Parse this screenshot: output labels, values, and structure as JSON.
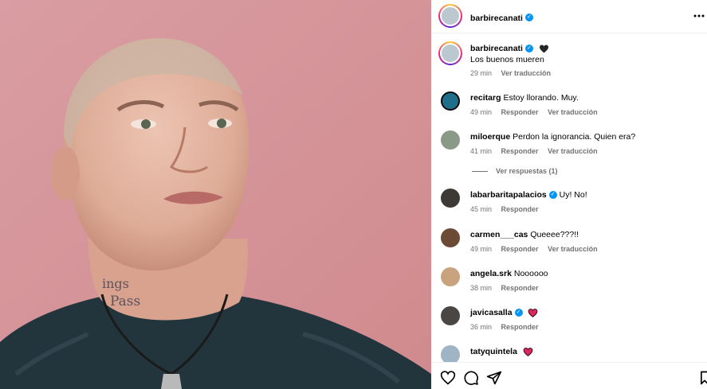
{
  "header": {
    "username": "barbirecanati",
    "verified": true
  },
  "caption": {
    "username": "barbirecanati",
    "text": "Los buenos mueren",
    "time": "29 min",
    "translate": "Ver traducción"
  },
  "comments": [
    {
      "username": "recitarg",
      "text": "Estoy llorando. Muy.",
      "time": "49 min",
      "reply": "Responder",
      "translate": "Ver traducción"
    },
    {
      "username": "miloerque",
      "text": "Perdon la ignorancia. Quien era?",
      "time": "41 min",
      "reply": "Responder",
      "translate": "Ver traducción"
    },
    {
      "username": "labarbaritapalacios",
      "text": "Uy! No!",
      "time": "45 min",
      "reply": "Responder"
    },
    {
      "username": "carmen___cas",
      "text": "Queeee???!!",
      "time": "49 min",
      "reply": "Responder",
      "translate": "Ver traducción"
    },
    {
      "username": "angela.srk",
      "text": "Noooooo",
      "time": "38 min",
      "reply": "Responder"
    },
    {
      "username": "javicasalla",
      "text": "",
      "time": "36 min",
      "reply": "Responder"
    },
    {
      "username": "tatyquintela",
      "text": ""
    }
  ],
  "view_replies": "Ver respuestas (1)",
  "photo": {
    "tattoo_line1": "ings",
    "tattoo_line2": "Pass"
  },
  "colors": {
    "verified": "#0095f6",
    "meta": "#737373",
    "heart_red": "#e0245e",
    "heart_black": "#262626",
    "photo_bg": "#d89a9c"
  },
  "icons": [
    "more-icon",
    "heart-icon",
    "comment-icon",
    "share-icon",
    "bookmark-icon",
    "verified-badge-icon"
  ]
}
